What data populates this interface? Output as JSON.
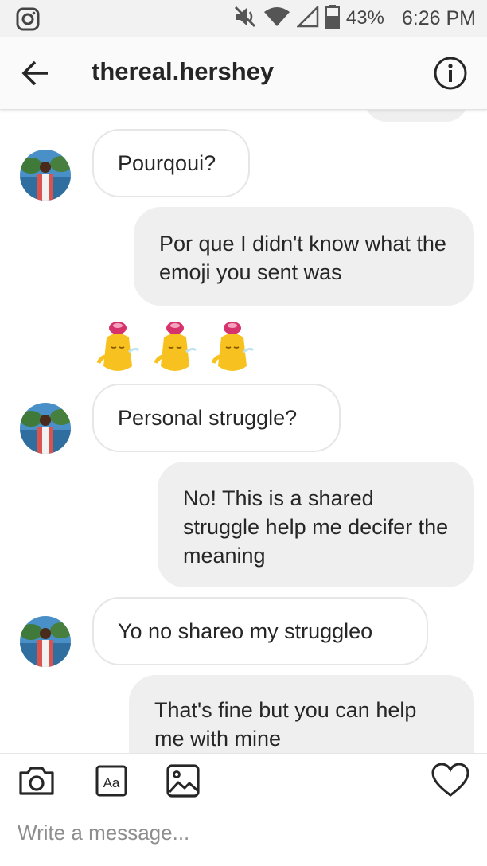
{
  "status_bar": {
    "battery": "43%",
    "time": "6:26 PM"
  },
  "header": {
    "title": "thereal.hershey"
  },
  "messages": [
    {
      "direction": "in",
      "text": "Pourqoui?"
    },
    {
      "direction": "out",
      "text": "Por que I didn't know what the emoji you sent was"
    },
    {
      "direction": "in",
      "text": "Personal struggle?"
    },
    {
      "direction": "out",
      "text": "No! This is a shared struggle help me decifer the meaning"
    },
    {
      "direction": "in",
      "text": "Yo no shareo my struggleo"
    },
    {
      "direction": "out",
      "text": "That's fine but you can help me with mine"
    }
  ],
  "composer": {
    "placeholder": "Write a message...",
    "text_tool_label": "Aa"
  }
}
